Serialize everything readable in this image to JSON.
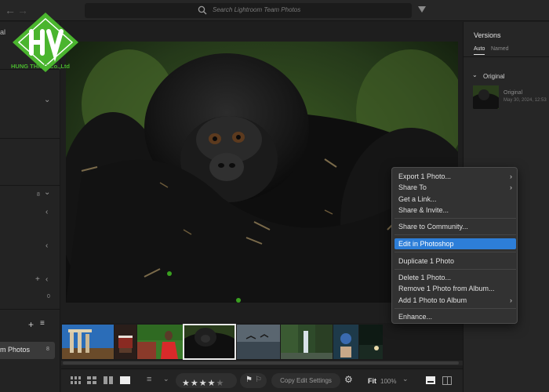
{
  "search": {
    "placeholder": "Search Lightroom Team Photos"
  },
  "left_panel": {
    "partial_top_label": "al",
    "album_label": "m Photos",
    "album_count": "8",
    "count_a": "8",
    "count_b": "0"
  },
  "logo": {
    "text": "HUNG THINH Co.,Ltd"
  },
  "versions_panel": {
    "title": "Versions",
    "tabs": [
      "Auto",
      "Named"
    ],
    "group": "Original",
    "item_name": "Original",
    "item_date": "May 30, 2024, 12:53"
  },
  "context_menu": {
    "items": [
      {
        "label": "Export 1 Photo...",
        "submenu": true
      },
      {
        "label": "Share To",
        "submenu": true
      },
      {
        "label": "Get a Link...",
        "submenu": false
      },
      {
        "label": "Share & Invite...",
        "submenu": false
      },
      {
        "label": "Share to Community...",
        "submenu": false
      },
      {
        "label": "Edit in Photoshop",
        "submenu": false,
        "highlighted": true
      },
      {
        "label": "Duplicate 1 Photo",
        "submenu": false
      },
      {
        "label": "Delete 1 Photo...",
        "submenu": false
      },
      {
        "label": "Remove 1 Photo from Album...",
        "submenu": false
      },
      {
        "label": "Add 1 Photo to Album",
        "submenu": true
      },
      {
        "label": "Enhance...",
        "submenu": false
      }
    ]
  },
  "bottom_bar": {
    "copy_edit_label": "Copy Edit Settings",
    "fit_label": "Fit",
    "zoom_label": "100%",
    "rating_stars": 4,
    "rating_max": 5
  },
  "filmstrip": {
    "thumbnails": [
      "ruins",
      "cake",
      "woman-portrait",
      "gorilla",
      "beach-birds",
      "waterfall",
      "hand-device",
      "night-scene"
    ],
    "selected_index": 3
  },
  "colors": {
    "accent": "#2d7ed8",
    "logo_green": "#4ab52e",
    "panel_bg": "#262626",
    "app_bg": "#1e1e1e"
  }
}
